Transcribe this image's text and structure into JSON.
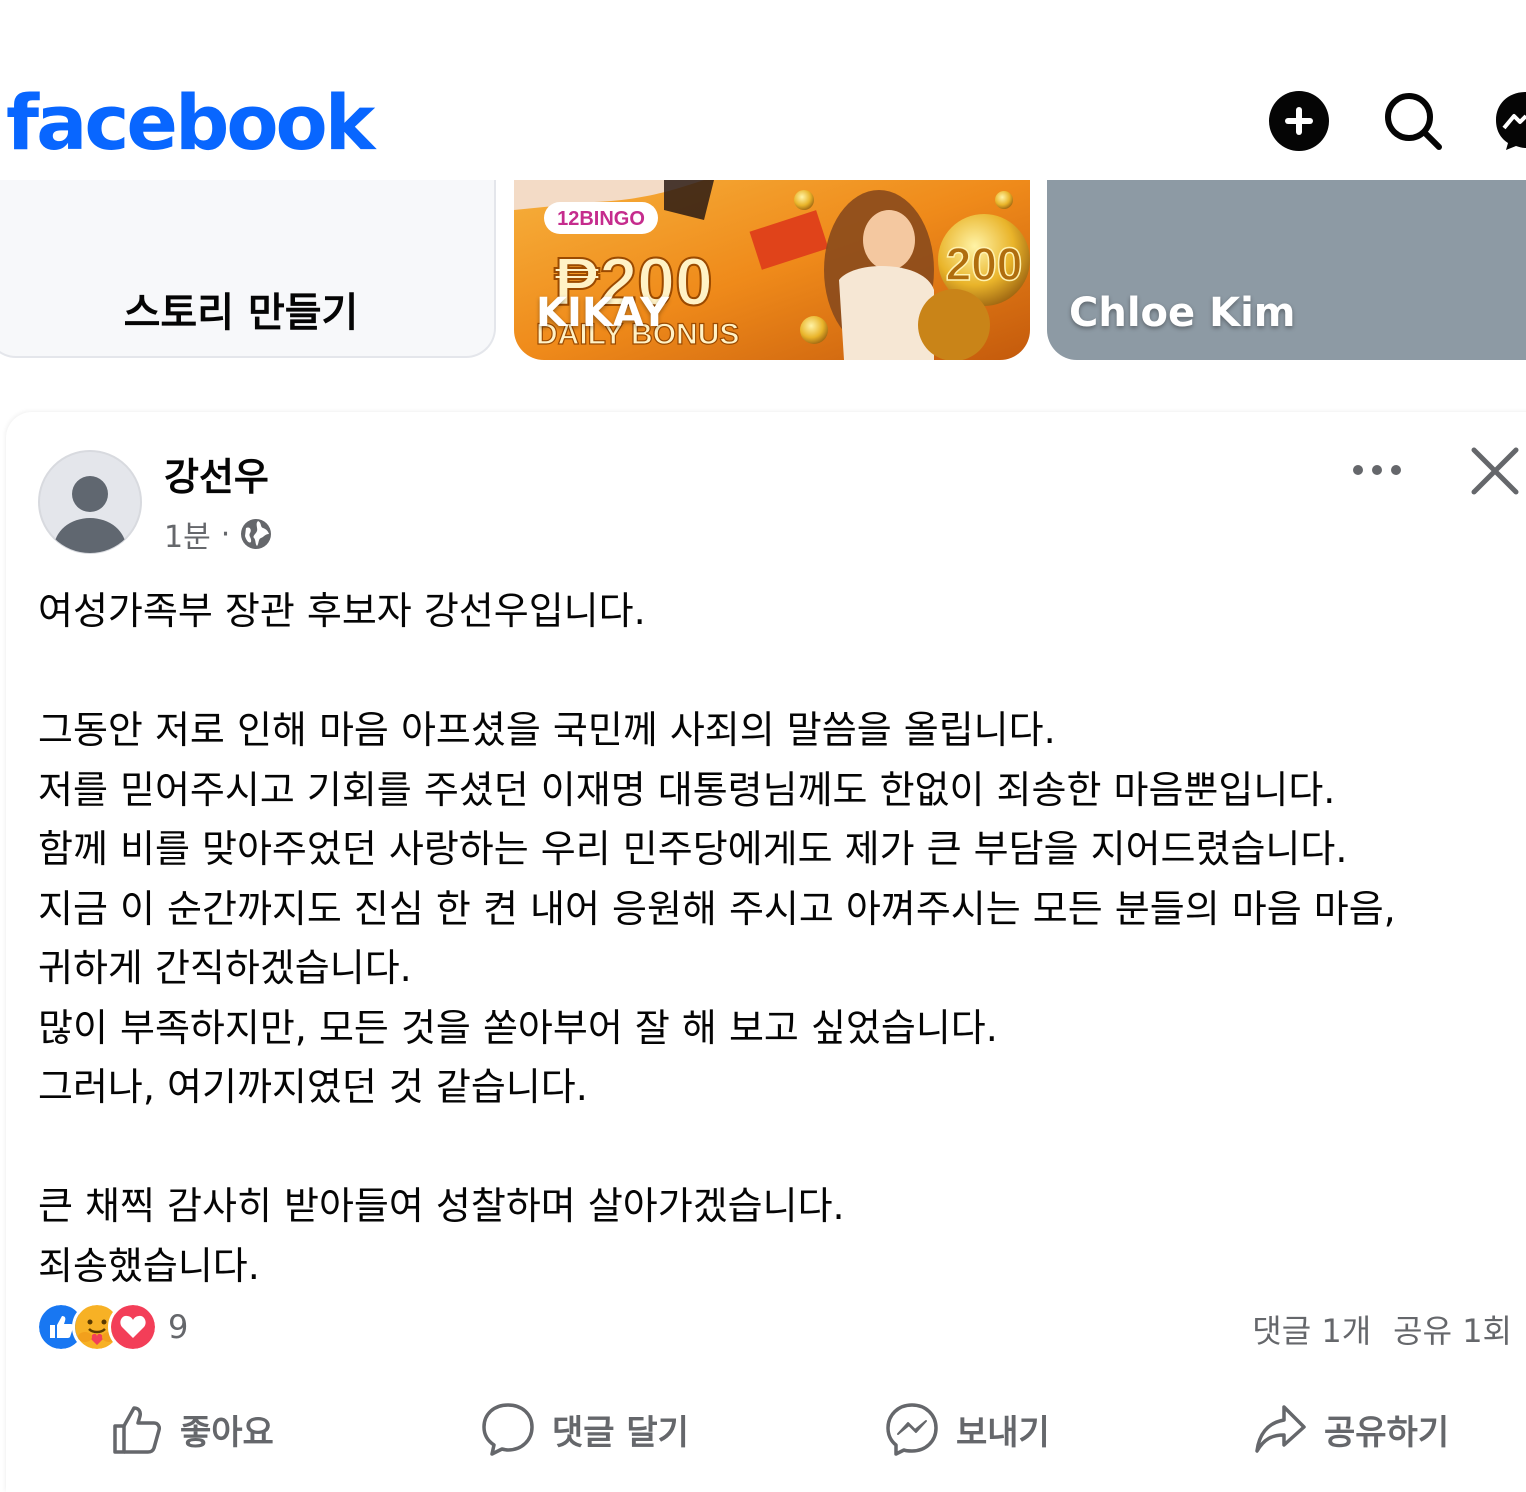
{
  "header": {
    "logo_text": "facebook",
    "brand_color": "#0866ff",
    "icons": [
      "plus-circle-icon",
      "search-icon",
      "messenger-icon"
    ]
  },
  "stories": {
    "create_label": "스토리 만들기",
    "items": [
      {
        "name": "KIKAY",
        "ad_brand": "12BINGO",
        "ad_amount": "₱200",
        "ad_badge": "200",
        "ad_caption": "DAILY BONUS"
      },
      {
        "name": "Chloe Kim"
      }
    ]
  },
  "post": {
    "author": "강선우",
    "time": "1분",
    "separator": "·",
    "privacy_icon": "globe-icon",
    "lines": [
      "여성가족부 장관 후보자 강선우입니다.",
      "",
      "그동안 저로 인해 마음 아프셨을 국민께 사죄의 말씀을 올립니다.",
      "저를 믿어주시고 기회를 주셨던 이재명 대통령님께도 한없이 죄송한 마음뿐입니다.",
      "함께 비를 맞아주었던 사랑하는 우리 민주당에게도 제가 큰 부담을 지어드렸습니다.",
      "지금 이 순간까지도 진심 한 켠 내어 응원해 주시고 아껴주시는 모든 분들의 마음 마음,",
      "귀하게 간직하겠습니다.",
      "많이 부족하지만, 모든 것을 쏟아부어 잘 해 보고 싶었습니다.",
      "그러나, 여기까지였던 것 같습니다.",
      "",
      "큰 채찍 감사히 받아들여 성찰하며 살아가겠습니다.",
      "죄송했습니다."
    ],
    "reaction_count": "9",
    "reaction_icons": [
      "like-icon",
      "care-icon",
      "love-icon"
    ],
    "comments": "댓글 1개",
    "shares": "공유 1회",
    "actions": {
      "like": "좋아요",
      "comment": "댓글 달기",
      "send": "보내기",
      "share": "공유하기"
    }
  }
}
